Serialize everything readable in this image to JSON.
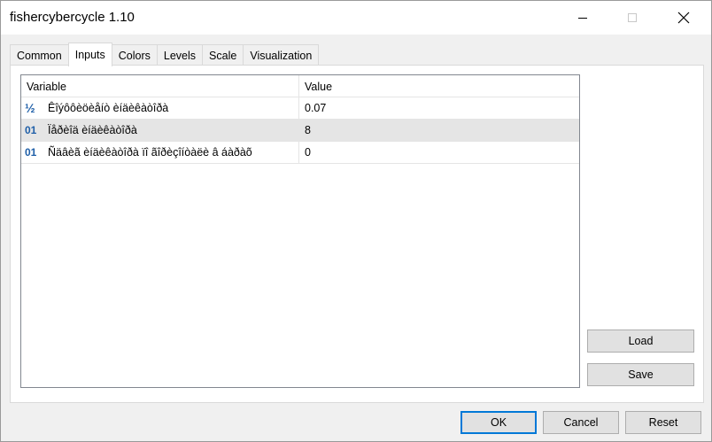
{
  "window": {
    "title": "fishercybercycle 1.10"
  },
  "tabs": [
    {
      "label": "Common"
    },
    {
      "label": "Inputs"
    },
    {
      "label": "Colors"
    },
    {
      "label": "Levels"
    },
    {
      "label": "Scale"
    },
    {
      "label": "Visualization"
    }
  ],
  "active_tab": "Inputs",
  "grid": {
    "headers": {
      "variable": "Variable",
      "value": "Value"
    },
    "rows": [
      {
        "type_icon": "½",
        "icon_name": "fraction-icon",
        "variable": "Êîýôôèöèåíò èíäèêàòîðà",
        "value": "0.07"
      },
      {
        "type_icon": "01",
        "icon_name": "integer-icon",
        "variable": "Ïåðèîä èíäèêàòîðà",
        "value": "8"
      },
      {
        "type_icon": "01",
        "icon_name": "integer-icon",
        "variable": "Ñäâèã èíäèêàòîðà ïî ãîðèçîíòàëè â áàðàõ",
        "value": "0"
      }
    ]
  },
  "buttons": {
    "load": "Load",
    "save": "Save",
    "ok": "OK",
    "cancel": "Cancel",
    "reset": "Reset"
  },
  "colors": {
    "accent": "#0078d7",
    "icon": "#1f5fa8",
    "selected_row": "#e5e5e5"
  }
}
